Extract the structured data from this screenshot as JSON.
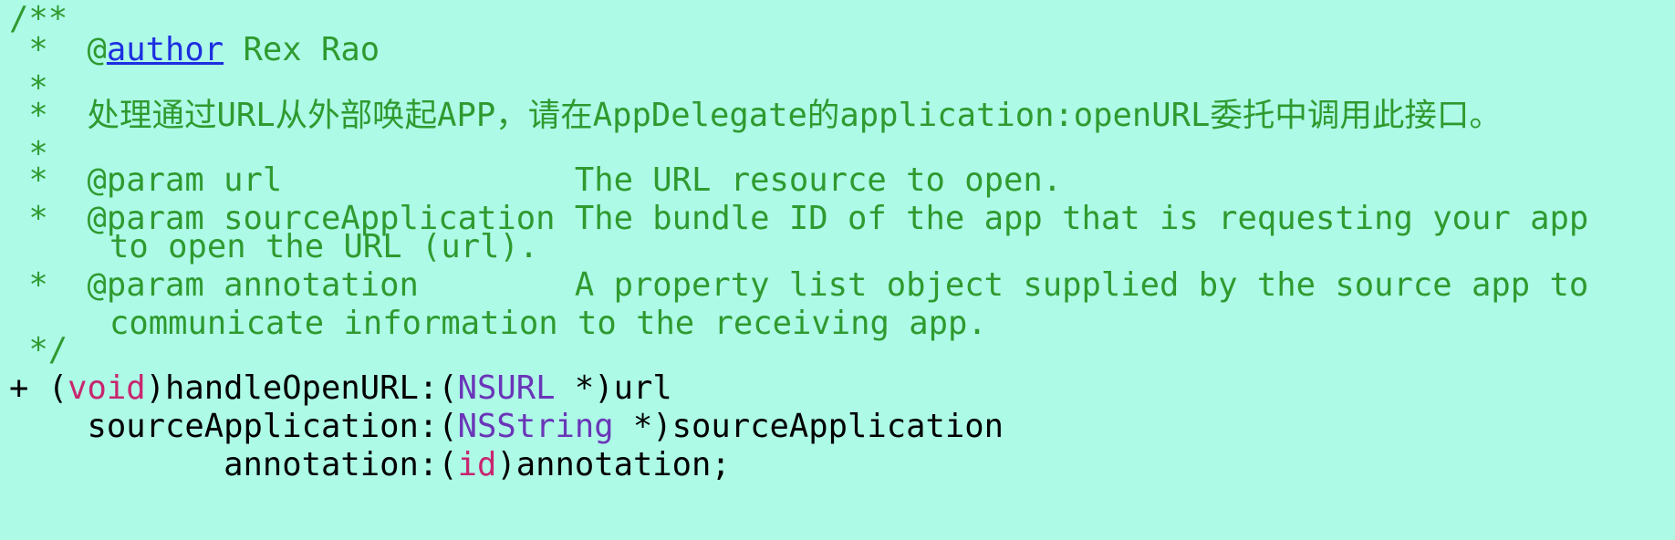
{
  "code": {
    "doc_open": "/**",
    "star": " *",
    "star_prefix": " *  ",
    "author_at": "@",
    "author_tag": "author",
    "author_name": " Rex Rao",
    "description": "处理通过URL从外部唤起APP，请在AppDelegate的application:openURL委托中调用此接口。",
    "param_url": "@param url               The URL resource to open.",
    "param_source": "@param sourceApplication The bundle ID of the app that is requesting your app",
    "param_source_cont": "to open the URL (url).",
    "param_annotation": "@param annotation        A property list object supplied by the source app to",
    "param_annotation_cont": "communicate information to the receiving app.",
    "doc_close": " */",
    "sig_plus": "+ (",
    "sig_void": "void",
    "sig_method": ")handleOpenURL:(",
    "sig_nsurl": "NSURL",
    "sig_url_arg": " *)url",
    "sig_source_label": "    sourceApplication:(",
    "sig_nsstring": "NSString",
    "sig_source_arg": " *)sourceApplication",
    "sig_annotation_label": "           annotation:(",
    "sig_id": "id",
    "sig_annotation_arg": ")annotation;"
  },
  "colors": {
    "background": "#adfae6",
    "comment": "#2f9a2f",
    "keyword": "#c8266f",
    "type": "#6a36b8",
    "doc_link": "#1d2fe0",
    "plain": "#000000"
  }
}
